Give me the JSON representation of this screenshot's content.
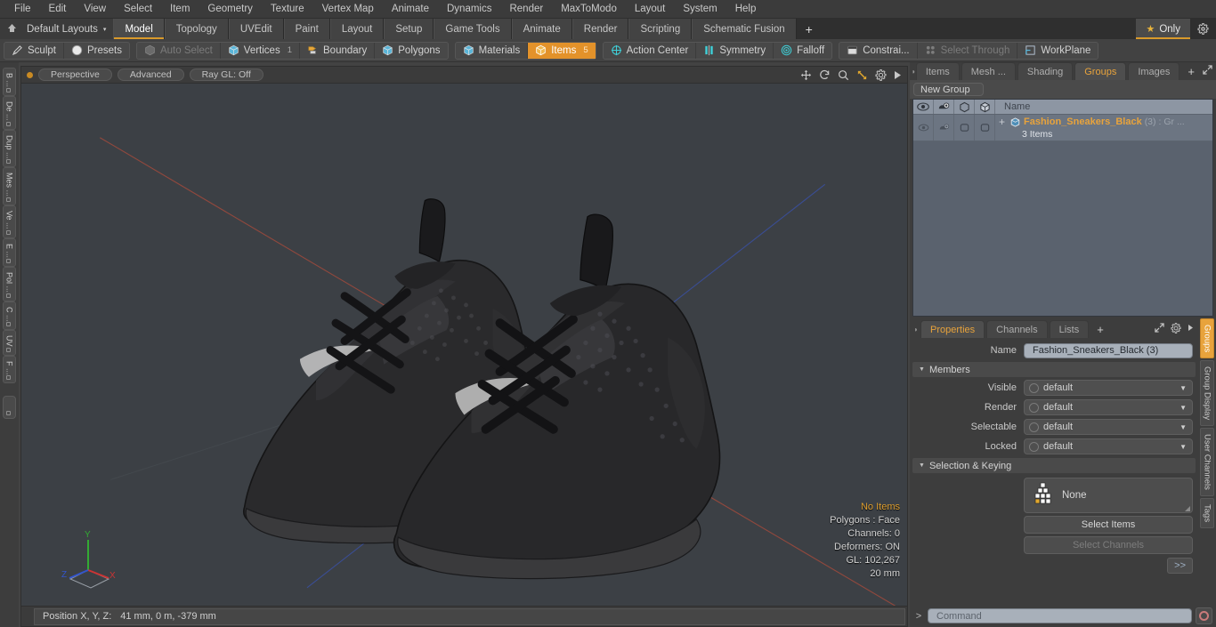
{
  "menubar": {
    "items": [
      "File",
      "Edit",
      "View",
      "Select",
      "Item",
      "Geometry",
      "Texture",
      "Vertex Map",
      "Animate",
      "Dynamics",
      "Render",
      "MaxToModo",
      "Layout",
      "System",
      "Help"
    ]
  },
  "layout_bar": {
    "home_icon": "home-icon",
    "layouts_label": "Default Layouts",
    "caret": "▾",
    "tabs": [
      {
        "label": "Model",
        "active": true
      },
      {
        "label": "Topology",
        "active": false
      },
      {
        "label": "UVEdit",
        "active": false
      },
      {
        "label": "Paint",
        "active": false
      },
      {
        "label": "Layout",
        "active": false
      },
      {
        "label": "Setup",
        "active": false
      },
      {
        "label": "Game Tools",
        "active": false
      },
      {
        "label": "Animate",
        "active": false
      },
      {
        "label": "Render",
        "active": false
      },
      {
        "label": "Scripting",
        "active": false
      },
      {
        "label": "Schematic Fusion",
        "active": false
      }
    ],
    "add_tab_label": "+",
    "only_label": "Only",
    "only_star": "★",
    "gear_icon": "gear-icon",
    "accent_color": "#d99a2b"
  },
  "modebar": {
    "group_tools": [
      {
        "label": "Sculpt",
        "icon": "pencil-icon",
        "dim": false,
        "selected": false,
        "count": ""
      },
      {
        "label": "Presets",
        "icon": "sphere-icon",
        "dim": false,
        "selected": false,
        "count": ""
      }
    ],
    "group_select": [
      {
        "label": "Auto Select",
        "icon": "cube-gray-icon",
        "dim": true,
        "selected": false,
        "count": ""
      },
      {
        "label": "Vertices",
        "icon": "cube-icon",
        "dim": false,
        "selected": false,
        "count": "1"
      },
      {
        "label": "Boundary",
        "icon": "boundary-icon",
        "dim": false,
        "selected": false,
        "count": ""
      },
      {
        "label": "Polygons",
        "icon": "cube-icon",
        "dim": false,
        "selected": false,
        "count": ""
      }
    ],
    "group_items": [
      {
        "label": "Materials",
        "icon": "cube-icon",
        "dim": false,
        "selected": false,
        "count": ""
      },
      {
        "label": "Items",
        "icon": "cube-icon",
        "dim": false,
        "selected": true,
        "count": "5"
      }
    ],
    "group_center": [
      {
        "label": "Action Center",
        "icon": "crosshair-icon",
        "dim": false,
        "selected": false,
        "count": ""
      },
      {
        "label": "Symmetry",
        "icon": "symmetry-icon",
        "dim": false,
        "selected": false,
        "count": ""
      },
      {
        "label": "Falloff",
        "icon": "falloff-icon",
        "dim": false,
        "selected": false,
        "count": ""
      }
    ],
    "group_constraint": [
      {
        "label": "Constrai...",
        "icon": "constraint-icon",
        "dim": false,
        "selected": false,
        "count": ""
      },
      {
        "label": "Select Through",
        "icon": "select-through-icon",
        "dim": true,
        "selected": false,
        "count": ""
      },
      {
        "label": "WorkPlane",
        "icon": "workplane-icon",
        "dim": false,
        "selected": false,
        "count": ""
      }
    ],
    "selected_color": "#e3922a"
  },
  "left_strip": {
    "tabs": [
      "B ...",
      "De ...",
      "Dup ...",
      "Mes ...",
      "Ve ...",
      "E ...",
      "Pol ...",
      "C ...",
      "UV",
      "F ..."
    ]
  },
  "viewport": {
    "header": {
      "dot_color": "#c98a23",
      "buttons": [
        "Perspective",
        "Advanced",
        "Ray GL: Off"
      ],
      "icons": [
        "move-icon",
        "rotate-icon",
        "zoom-icon",
        "fit-icon",
        "gear-icon",
        "play-icon"
      ]
    },
    "stats": {
      "items": "No Items",
      "polygons": "Polygons : Face",
      "channels": "Channels: 0",
      "deformers": "Deformers: ON",
      "gl": "GL: 102,267",
      "scale": "20 mm",
      "highlight_color": "#e0a030"
    },
    "axis": {
      "x": "X",
      "y": "Y",
      "z": "Z",
      "x_color": "#cc3333",
      "y_color": "#33aa33",
      "z_color": "#3355cc"
    },
    "background_color": "#3c4045"
  },
  "statusbar": {
    "position_label": "Position X, Y, Z:",
    "position_value": "41 mm, 0 m, -379 mm"
  },
  "right_panel": {
    "tabs": [
      {
        "label": "Items",
        "active": false
      },
      {
        "label": "Mesh ...",
        "active": false
      },
      {
        "label": "Shading",
        "active": false
      },
      {
        "label": "Groups",
        "active": true
      },
      {
        "label": "Images",
        "active": false
      }
    ],
    "add_tab": "+",
    "header_icons": [
      "expand-icon",
      "chevron-right-icon"
    ],
    "new_group_label": "New Group",
    "group_list": {
      "columns": [
        "eye-icon",
        "render-icon",
        "cube-outline-icon",
        "cube-solid-icon"
      ],
      "name_column": "Name",
      "rows": [
        {
          "expand": "+",
          "name": "Fashion_Sneakers_Black",
          "count": "(3)",
          "suffix": ": Gr ...",
          "sub": "3 Items",
          "icon": "group-cube-icon"
        }
      ]
    },
    "properties": {
      "tabs": [
        {
          "label": "Properties",
          "active": true
        },
        {
          "label": "Channels",
          "active": false
        },
        {
          "label": "Lists",
          "active": false
        }
      ],
      "add_tab": "+",
      "icons": [
        "expand-icon",
        "gear-icon",
        "chevron-right-icon"
      ],
      "name_label": "Name",
      "name_value": "Fashion_Sneakers_Black (3)",
      "members_section": "Members",
      "member_rows": [
        {
          "label": "Visible",
          "value": "default"
        },
        {
          "label": "Render",
          "value": "default"
        },
        {
          "label": "Selectable",
          "value": "default"
        },
        {
          "label": "Locked",
          "value": "default"
        }
      ],
      "selection_section": "Selection & Keying",
      "selection_none": "None",
      "select_items_label": "Select Items",
      "select_channels_label": "Select Channels",
      "expand_label": ">>"
    },
    "right_tabs": [
      {
        "label": "Groups",
        "active": true
      },
      {
        "label": "Group Display",
        "active": false
      },
      {
        "label": "User Channels",
        "active": false
      },
      {
        "label": "Tags",
        "active": false
      }
    ],
    "accent_color": "#e8a33c"
  },
  "command_bar": {
    "prompt": ">",
    "placeholder": "Command",
    "record_icon": "record-icon"
  }
}
